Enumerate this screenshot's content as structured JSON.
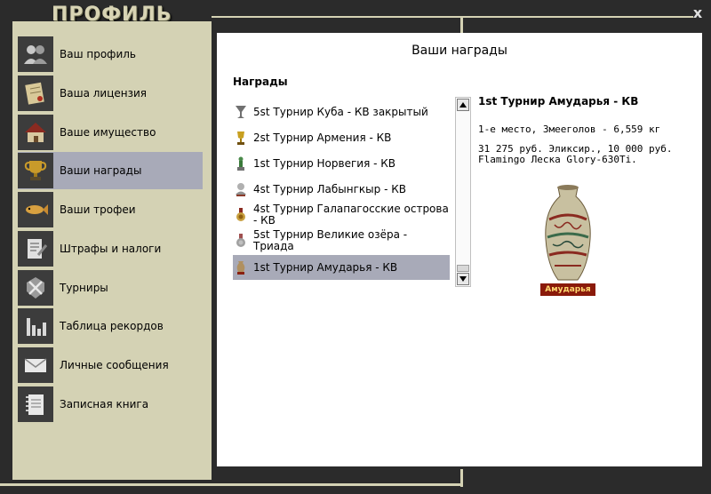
{
  "window": {
    "title": "ПРОФИЛЬ",
    "close_label": "x"
  },
  "sidebar": {
    "items": [
      {
        "label": "Ваш профиль",
        "icon": "users-icon"
      },
      {
        "label": "Ваша лицензия",
        "icon": "license-icon"
      },
      {
        "label": "Ваше имущество",
        "icon": "house-icon"
      },
      {
        "label": "Ваши награды",
        "icon": "trophy-icon",
        "active": true
      },
      {
        "label": "Ваши трофеи",
        "icon": "fish-icon"
      },
      {
        "label": "Штрафы и налоги",
        "icon": "fines-icon"
      },
      {
        "label": "Турниры",
        "icon": "tournament-icon"
      },
      {
        "label": "Таблица рекордов",
        "icon": "records-icon"
      },
      {
        "label": "Личные сообщения",
        "icon": "mail-icon"
      },
      {
        "label": "Записная книга",
        "icon": "notebook-icon"
      }
    ]
  },
  "main": {
    "title": "Ваши награды",
    "awards_heading": "Награды",
    "awards": [
      {
        "label": "5st Турнир Куба - КВ закрытый",
        "icon": "cup-icon"
      },
      {
        "label": "2st Турнир Армения - КВ",
        "icon": "gold-cup-icon"
      },
      {
        "label": "1st Турнир Норвегия - КВ",
        "icon": "green-statue-icon"
      },
      {
        "label": "4st Турнир Лабынгкыр - КВ",
        "icon": "bust-icon"
      },
      {
        "label": "4st Турнир Галапагосские острова - КВ",
        "icon": "medal-icon"
      },
      {
        "label": "5st Турнир Великие озёра - Триада",
        "icon": "medal-icon"
      },
      {
        "label": "1st Турнир Амударья - КВ",
        "icon": "vase-icon",
        "selected": true
      }
    ],
    "detail": {
      "title": "1st Турнир Амударья - КВ",
      "place_line": "1-е место, Змееголов - 6,559 кг",
      "prize_line": "31 275 руб. Эликсир., 10 000 руб. Flamingo Леска Glory-630Ti.",
      "image_caption": "Амударья"
    }
  },
  "colors": {
    "background": "#2b2b2b",
    "sidebar": "#d4d2b4",
    "selected": "#a8aab8",
    "content": "#ffffff"
  }
}
